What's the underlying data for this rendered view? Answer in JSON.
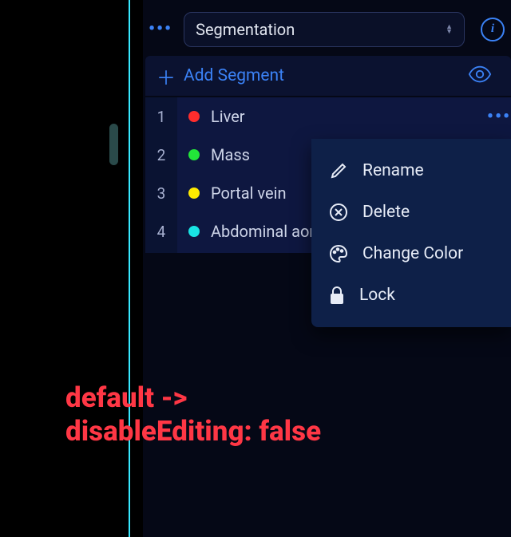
{
  "header": {
    "select_label": "Segmentation"
  },
  "add": {
    "label": "Add Segment"
  },
  "segments": [
    {
      "num": "1",
      "name": "Liver",
      "color": "#ff2d2d"
    },
    {
      "num": "2",
      "name": "Mass",
      "color": "#22e639"
    },
    {
      "num": "3",
      "name": "Portal vein",
      "color": "#ffea00"
    },
    {
      "num": "4",
      "name": "Abdominal aor",
      "color": "#19e3e3"
    }
  ],
  "menu": {
    "rename": "Rename",
    "delete": "Delete",
    "change_color": "Change Color",
    "lock": "Lock"
  },
  "annotation": {
    "line1": "default ->",
    "line2": "disableEditing: false"
  }
}
